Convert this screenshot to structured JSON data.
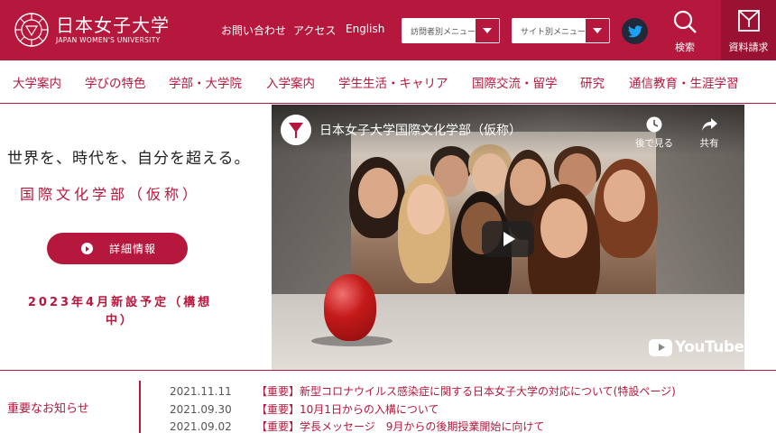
{
  "header": {
    "logo_jp": "日本女子大学",
    "logo_en": "JAPAN WOMEN'S UNIVERSITY",
    "links": [
      {
        "label": "お問い合わせ"
      },
      {
        "label": "アクセス"
      },
      {
        "label": "English"
      }
    ],
    "visitor_menu": {
      "label": "訪問者別メニュー"
    },
    "site_menu": {
      "label": "サイト別メニュー"
    },
    "search_label": "検索",
    "docs_label": "資料請求",
    "brand_color": "#b5173d"
  },
  "nav": {
    "items": [
      {
        "label": "大学案内"
      },
      {
        "label": "学びの特色"
      },
      {
        "label": "学部・大学院"
      },
      {
        "label": "入学案内"
      },
      {
        "label": "学生生活・キャリア"
      },
      {
        "label": "国際交流・留学"
      },
      {
        "label": "研究"
      },
      {
        "label": "通信教育・生涯学習"
      }
    ]
  },
  "hero": {
    "tagline": "世界を、時代を、自分を超える。",
    "faculty": "国際文化学部（仮称）",
    "detail_button": "詳細情報",
    "schedule": "2023年4月新設予定（構想中）"
  },
  "video": {
    "title": "日本女子大学国際文化学部（仮称）",
    "watch_later": "後で見る",
    "share": "共有",
    "youtube_label": "YouTube"
  },
  "news": {
    "heading": "重要なお知らせ",
    "items": [
      {
        "date": "2021.11.11",
        "title": "【重要】新型コロナウイルス感染症に関する日本女子大学の対応について(特設ページ)"
      },
      {
        "date": "2021.09.30",
        "title": "【重要】10月1日からの入構について"
      },
      {
        "date": "2021.09.02",
        "title": "【重要】学長メッセージ　9月からの後期授業開始に向けて"
      }
    ]
  }
}
